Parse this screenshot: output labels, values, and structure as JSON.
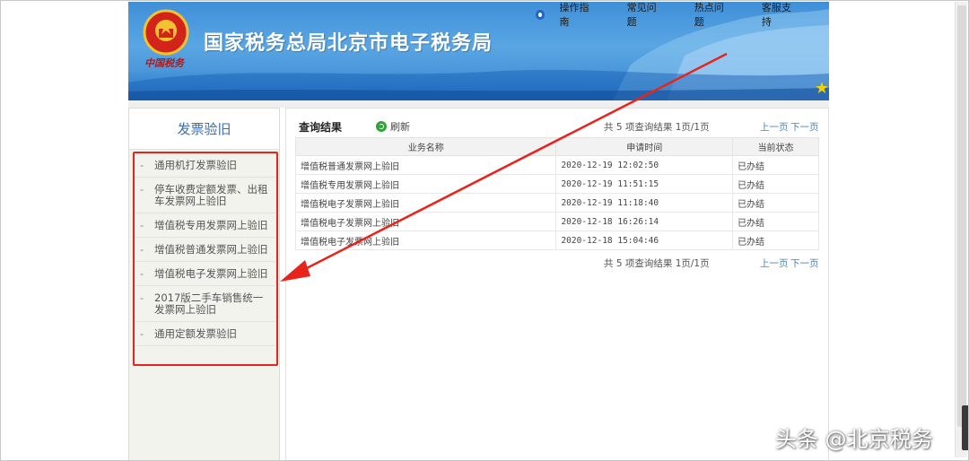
{
  "header": {
    "site_title": "国家税务总局北京市电子税务局",
    "emblem_caption": "中国税务",
    "nav_items": [
      {
        "label": "操作指南"
      },
      {
        "label": "常见问题"
      },
      {
        "label": "热点问题"
      },
      {
        "label": "客服支持"
      }
    ]
  },
  "sidebar": {
    "title": "发票验旧",
    "items": [
      {
        "label": "通用机打发票验旧"
      },
      {
        "label": "停车收费定额发票、出租车发票网上验旧"
      },
      {
        "label": "增值税专用发票网上验旧"
      },
      {
        "label": "增值税普通发票网上验旧"
      },
      {
        "label": "增值税电子发票网上验旧"
      },
      {
        "label": "2017版二手车销售统一发票网上验旧"
      },
      {
        "label": "通用定额发票验旧"
      }
    ],
    "dash": "-"
  },
  "main": {
    "title": "查询结果",
    "refresh_label": "刷新",
    "pager_top": "共 5 项查询结果 1页/1页",
    "pager_bottom": "共 5 项查询结果 1页/1页",
    "prev_label": "上一页",
    "next_label": "下一页",
    "columns": [
      "业务名称",
      "申请时间",
      "当前状态"
    ],
    "rows": [
      {
        "name": "增值税普通发票网上验旧",
        "time": "2020-12-19 12:02:50",
        "status": "已办结"
      },
      {
        "name": "增值税专用发票网上验旧",
        "time": "2020-12-19 11:51:15",
        "status": "已办结"
      },
      {
        "name": "增值税电子发票网上验旧",
        "time": "2020-12-19 11:18:40",
        "status": "已办结"
      },
      {
        "name": "增值税电子发票网上验旧",
        "time": "2020-12-18 16:26:14",
        "status": "已办结"
      },
      {
        "name": "增值税电子发票网上验旧",
        "time": "2020-12-18 15:04:46",
        "status": "已办结"
      }
    ]
  },
  "watermark": "头条 @北京税务",
  "colors": {
    "accent_blue": "#3f86c7",
    "annotation_red": "#e8231b",
    "header_blue": "#4a97da"
  },
  "icons": [
    "emblem-icon",
    "nav-dot-icon",
    "refresh-icon",
    "star-icon",
    "arrow-annotation"
  ]
}
